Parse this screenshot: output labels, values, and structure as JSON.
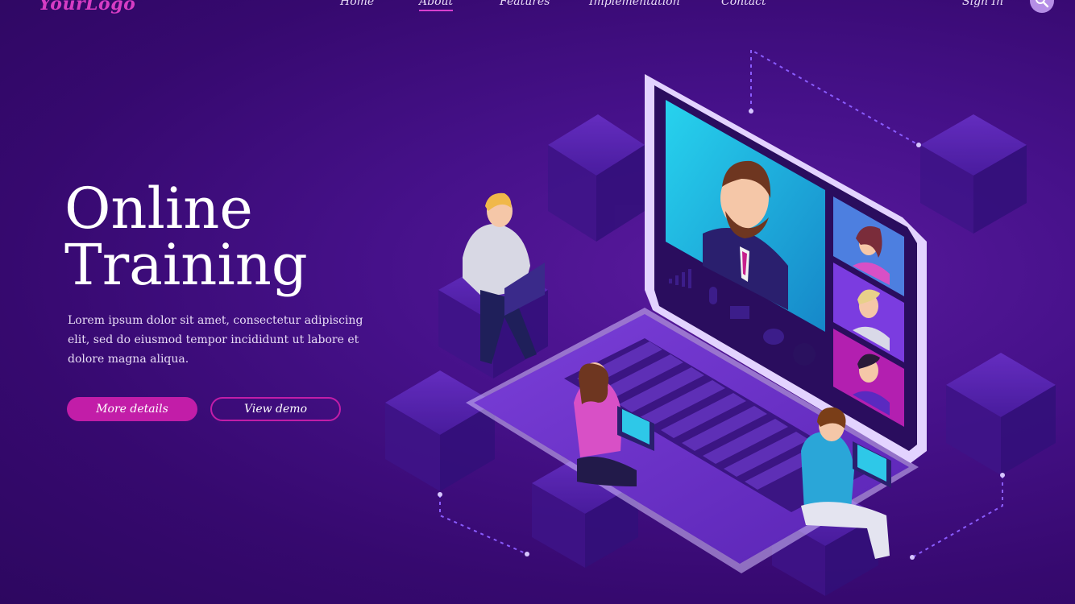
{
  "brand": {
    "logo": "YourLogo"
  },
  "nav": {
    "items": [
      {
        "label": "Home"
      },
      {
        "label": "About",
        "active": true
      },
      {
        "label": "Features"
      },
      {
        "label": "Implementation"
      },
      {
        "label": "Contact"
      }
    ],
    "sign_in": "Sign In",
    "search_icon": "search-icon"
  },
  "hero": {
    "title_line1": "Online",
    "title_line2": "Training",
    "description": "Lorem ipsum dolor sit amet, consectetur adipiscing elit, sed do eiusmod tempor incididunt ut labore et dolore magna aliqua.",
    "primary_button": "More details",
    "secondary_button": "View demo"
  },
  "colors": {
    "background": "#3c0c7a",
    "accent": "#c21da8",
    "logo": "#d63cc4",
    "screen": "#1fb5dd"
  }
}
